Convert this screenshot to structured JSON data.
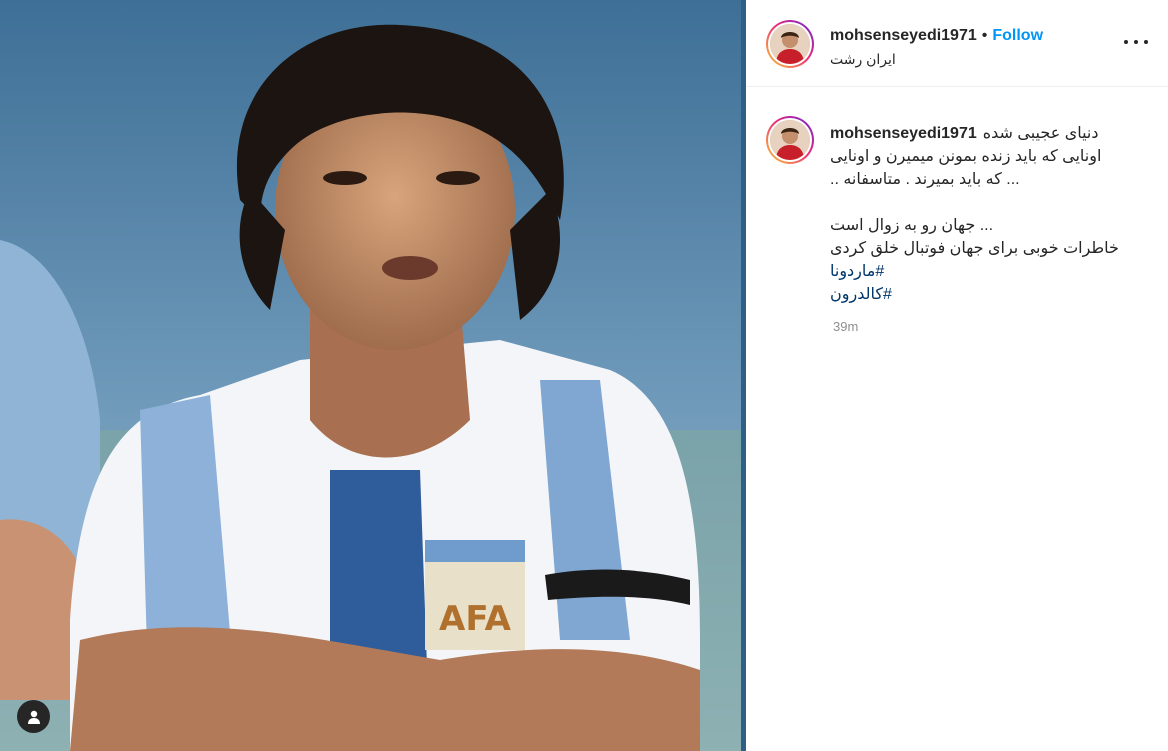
{
  "post": {
    "author": {
      "username": "mohsenseyedi1971",
      "follow_label": "Follow",
      "separator": "•",
      "location": "ایران رشت"
    },
    "caption": {
      "first_line": "دنیای عجیبی شده",
      "lines": [
        "اونایی که باید زنده بمونن میمیرن و اونایی",
        "... که باید بمیرند . متاسفانه ..",
        "",
        "... جهان رو به زوال است",
        "خاطرات خوبی برای جهان فوتبال خلق کردی"
      ],
      "hashtags": [
        "#ماردونا",
        "#کالدرون"
      ]
    },
    "timestamp": "39m",
    "icons": {
      "more_options": "more-horizontal-icon",
      "user_tags": "user-tag-icon"
    },
    "colors": {
      "follow": "#0095f6",
      "hashtag": "#00376b",
      "meta": "#8e8e8e",
      "avatar_ring": "#ee2a7b"
    }
  }
}
